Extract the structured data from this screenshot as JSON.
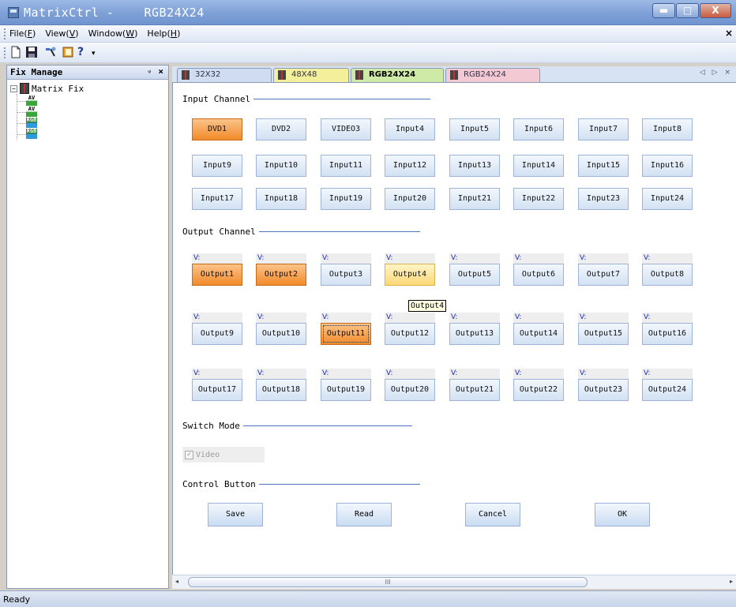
{
  "window": {
    "title": "MatrixCtrl -    RGB24X24",
    "buttons": {
      "minimize": "▬",
      "maximize": "□",
      "close": "X"
    }
  },
  "menu": {
    "items": [
      {
        "label": "File(",
        "key": "F",
        "end": ")"
      },
      {
        "label": "View(",
        "key": "V",
        "end": ")"
      },
      {
        "label": "Window(",
        "key": "W",
        "end": ")"
      },
      {
        "label": "Help(",
        "key": "H",
        "end": ")"
      }
    ],
    "close": "×"
  },
  "toolbar": {
    "icons": [
      "new-document-icon",
      "save-disk-icon",
      "tools-icon",
      "book-icon",
      "help-question-icon",
      "toolbar-overflow-icon"
    ],
    "help_glyph": "?",
    "overflow_glyph": "▾"
  },
  "left_panel": {
    "title": "Fix Manage",
    "pin": "ᵠ",
    "close": "×",
    "tree": {
      "root_toggle": "−",
      "root_label": "Matrix Fix",
      "children": [
        {
          "type": "AV",
          "label": "AV"
        },
        {
          "type": "AV",
          "label": "AV"
        },
        {
          "type": "RGB",
          "label": "RGB"
        },
        {
          "type": "RGB",
          "label": "RGB"
        }
      ]
    }
  },
  "tabs": {
    "items": [
      {
        "label": "32X32",
        "color": "#cfdcf1"
      },
      {
        "label": "48X48",
        "color": "#f4ef9a"
      },
      {
        "label": "RGB24X24",
        "color": "#cfe9a6",
        "active": true
      },
      {
        "label": "RGB24X24",
        "color": "#f3c9d3"
      }
    ],
    "arrows": "◁ ▷ ×"
  },
  "input_channel": {
    "title": "Input Channel",
    "buttons": [
      "DVD1",
      "DVD2",
      "VIDEO3",
      "Input4",
      "Input5",
      "Input6",
      "Input7",
      "Input8",
      "Input9",
      "Input10",
      "Input11",
      "Input12",
      "Input13",
      "Input14",
      "Input15",
      "Input16",
      "Input17",
      "Input18",
      "Input19",
      "Input20",
      "Input21",
      "Input22",
      "Input23",
      "Input24"
    ],
    "selected": [
      0
    ]
  },
  "output_channel": {
    "title": "Output Channel",
    "v_label": "V:",
    "buttons": [
      "Output1",
      "Output2",
      "Output3",
      "Output4",
      "Output5",
      "Output6",
      "Output7",
      "Output8",
      "Output9",
      "Output10",
      "Output11",
      "Output12",
      "Output13",
      "Output14",
      "Output15",
      "Output16",
      "Output17",
      "Output18",
      "Output19",
      "Output20",
      "Output21",
      "Output22",
      "Output23",
      "Output24"
    ],
    "selected": [
      0,
      1,
      10
    ],
    "hover": 3,
    "focus": 10,
    "tooltip": "Output4"
  },
  "switch_mode": {
    "title": "Switch Mode",
    "video_label": "Video",
    "checked": true,
    "check_glyph": "✓"
  },
  "control": {
    "title": "Control Button",
    "buttons": [
      "Save",
      "Read",
      "Cancel",
      "OK"
    ]
  },
  "scrollbar": {
    "left": "◂",
    "right": "▸",
    "grip": "III"
  },
  "status": {
    "text": "Ready"
  }
}
